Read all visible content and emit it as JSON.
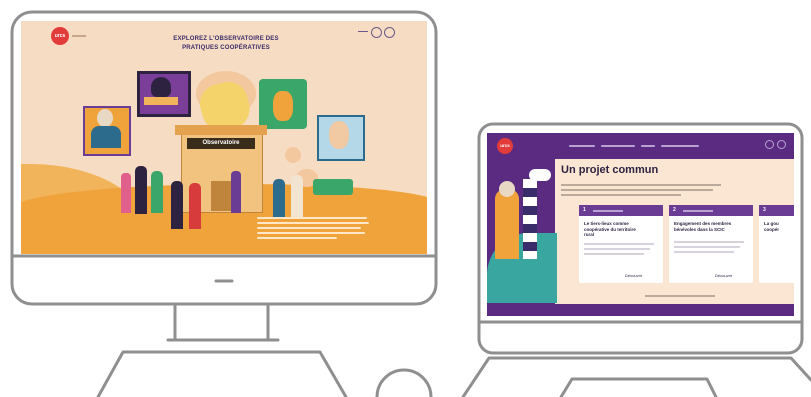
{
  "desktop": {
    "logo_text": "urcs",
    "headline_line1": "EXPLOREZ L'OBSERVATOIRE DES",
    "headline_line2": "PRATIQUES COOPÉRATIVES",
    "building_sign": "Observatoire"
  },
  "laptop": {
    "logo_text": "urcs",
    "page_title": "Un projet commun",
    "cards": [
      {
        "number": "1",
        "title_line1": "Le tiers-lieux comme",
        "title_line2": "coopérative du territoire",
        "title_line3": "rural",
        "link": "Découvrir"
      },
      {
        "number": "2",
        "title_line1": "Engagement des membres",
        "title_line2": "bénévoles dans la SCIC",
        "title_line3": "",
        "link": "Découvrir"
      },
      {
        "number": "3",
        "title_line1": "La gou",
        "title_line2": "coopér",
        "title_line3": "",
        "link": ""
      }
    ]
  },
  "colors": {
    "desktop_bg": "#f6dcc2",
    "orange": "#f0a33a",
    "purple": "#5b2b82",
    "logo_red": "#e23b3b",
    "device_gray": "#8f8f8f"
  }
}
